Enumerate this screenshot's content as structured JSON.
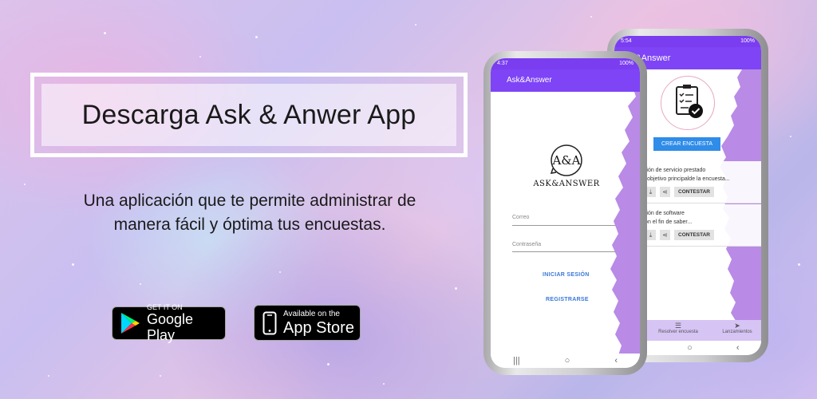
{
  "banner": {
    "title": "Descarga Ask & Anwer App",
    "subtitle_line1": "Una aplicación que te permite administrar de",
    "subtitle_line2": "manera fácil y óptima tus encuestas."
  },
  "badges": {
    "google_play": {
      "small": "GET IT ON",
      "big": "Google Play"
    },
    "app_store": {
      "small": "Available on the",
      "big": "App Store"
    }
  },
  "phone_front": {
    "status_time": "4:37",
    "status_right": "100%",
    "app_title": "Ask&Answer",
    "logo_mark": "A&A",
    "logo_text": "ASK&ANSWER",
    "email_label": "Correo",
    "password_label": "Contraseña",
    "login_button": "INICIAR SESIÓN",
    "register_button": "REGISTRARSE"
  },
  "phone_back": {
    "status_time": "5:54",
    "status_right": "100%",
    "app_title": "Ask&Answer",
    "create_button": "CREAR ENCUESTA",
    "surveys": [
      {
        "title": "ación de servicio prestado",
        "desc": "El objetivo principalde la encuesta...",
        "action": "CONTESTAR"
      },
      {
        "title": "ación de software",
        "desc": "Con el fin de saber...",
        "action": "CONTESTAR"
      }
    ],
    "bottom_nav": [
      {
        "label": "Resolver encuesta",
        "icon": "list-icon"
      },
      {
        "label": "Lanzamientos",
        "icon": "send-icon"
      }
    ]
  },
  "colors": {
    "primary": "#7e44f5",
    "status": "#7a3df0",
    "accent_blue": "#2f8ce8",
    "torn_purple": "#b98ae6"
  }
}
